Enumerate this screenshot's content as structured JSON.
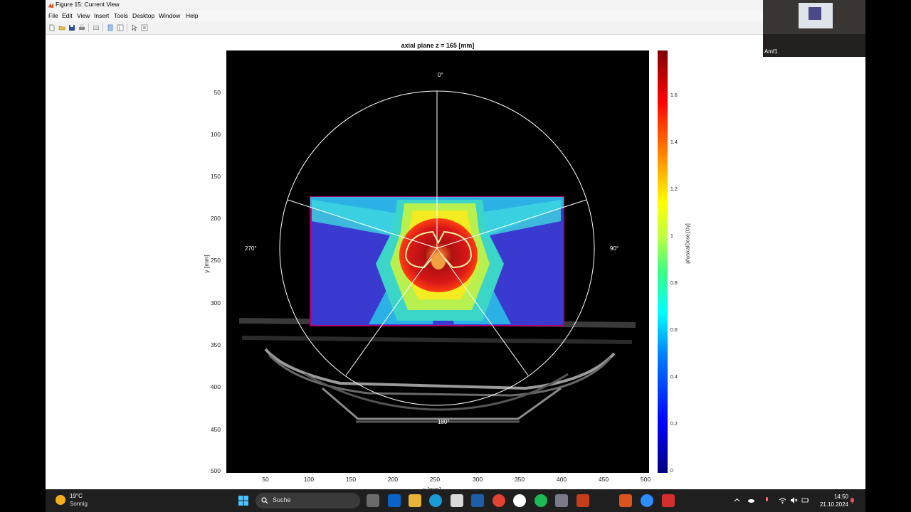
{
  "window": {
    "title": "Figure 15: Current View"
  },
  "menu": [
    "File",
    "Edit",
    "View",
    "Insert",
    "Tools",
    "Desktop",
    "Window",
    "Help"
  ],
  "plot": {
    "title": "axial plane z = 165 [mm]",
    "ylabel": "y [mm]",
    "xlabel": "x [mm]",
    "yticks": [
      "50",
      "100",
      "150",
      "200",
      "250",
      "300",
      "350",
      "400",
      "450",
      "500"
    ],
    "xticks": [
      "50",
      "100",
      "150",
      "200",
      "250",
      "300",
      "350",
      "400",
      "450",
      "500"
    ],
    "angles": {
      "top": "0°",
      "right": "90°",
      "bottom": "180°",
      "left": "270°"
    },
    "colorbar_label": "physicalDose [Gy]",
    "colorbar_ticks": [
      "0",
      "0.2",
      "0.4",
      "0.6",
      "0.8",
      "1",
      "1.2",
      "1.4",
      "1.6"
    ]
  },
  "camera": {
    "label": "Amf1"
  },
  "taskbar": {
    "weather_temp": "19°C",
    "weather_desc": "Sonnig",
    "search": "Suche",
    "time": "14:50",
    "date": "21.10.2024"
  }
}
